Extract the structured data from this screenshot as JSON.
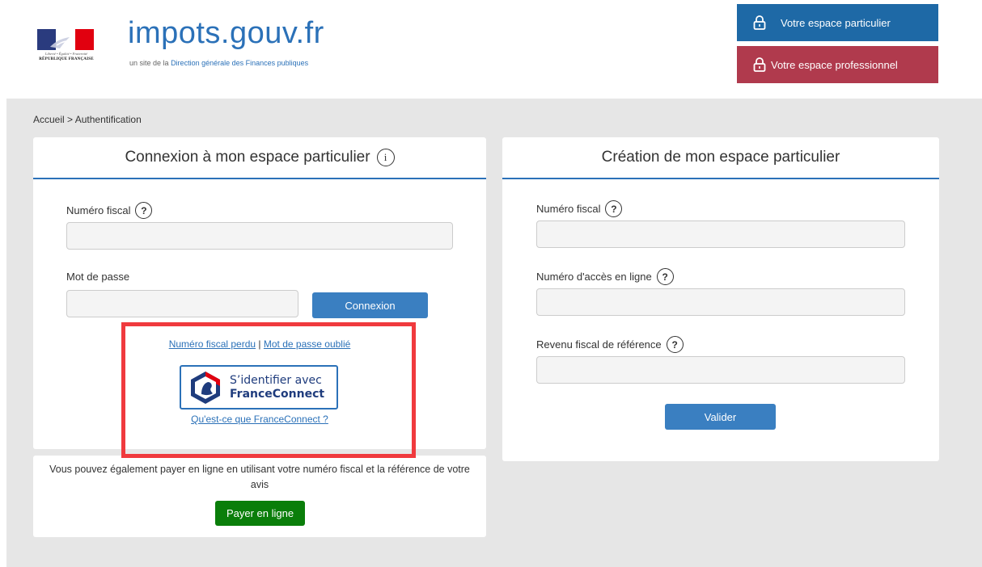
{
  "header": {
    "rf_motto": "Liberté • Égalité • Fraternité",
    "rf_name": "RÉPUBLIQUE FRANÇAISE",
    "brand_main": "impots",
    "brand_domain": ".gouv.fr",
    "brand_sub_prefix": "un site de la",
    "brand_sub_highlight": "Direction générale des Finances publiques",
    "btn_particulier": "Votre espace particulier",
    "btn_professionnel": "Votre espace professionnel",
    "colors": {
      "brand_blue": "#2b71b8",
      "particulier_bg": "#1e69a6",
      "pro_bg": "#b03a4d"
    }
  },
  "breadcrumb": {
    "home": "Accueil",
    "separator": ">",
    "current": "Authentification"
  },
  "login": {
    "title": "Connexion à mon espace particulier",
    "info_icon": "i",
    "fiscal_label": "Numéro fiscal",
    "fiscal_value": "",
    "password_label": "Mot de passe",
    "password_value": "",
    "submit": "Connexion",
    "link_lost_fiscal": "Numéro fiscal perdu",
    "link_sep": "|",
    "link_forgot_pwd": "Mot de passe oublié",
    "fc_line1": "S’identifier avec",
    "fc_line2": "FranceConnect",
    "fc_what": "Qu'est-ce que FranceConnect ?"
  },
  "pay": {
    "text": "Vous pouvez également payer en ligne en utilisant votre numéro fiscal et la référence de votre avis",
    "button": "Payer en ligne"
  },
  "create": {
    "title": "Création de mon espace particulier",
    "fiscal_label": "Numéro fiscal",
    "access_label": "Numéro d'accès en ligne",
    "revenue_label": "Revenu fiscal de référence",
    "submit": "Valider"
  },
  "help_glyph": "?"
}
